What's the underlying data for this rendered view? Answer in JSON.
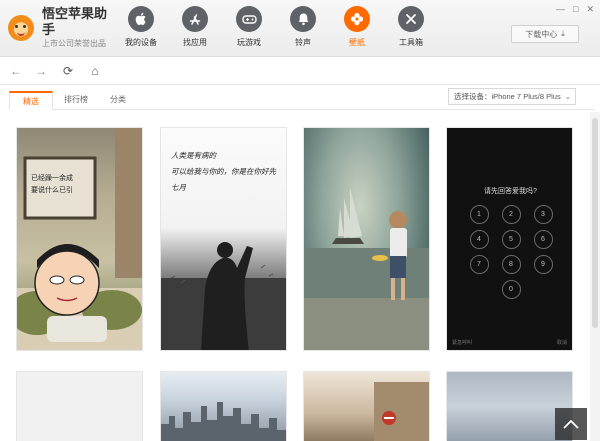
{
  "app": {
    "title": "悟空苹果助手",
    "subtitle": "上市公司荣誉出品"
  },
  "nav": [
    {
      "label": "我的设备",
      "icon": "apple-icon",
      "glyph": ""
    },
    {
      "label": "找应用",
      "icon": "app-store-icon",
      "glyph": "A"
    },
    {
      "label": "玩游戏",
      "icon": "gamepad-icon",
      "glyph": "◎"
    },
    {
      "label": "铃声",
      "icon": "bell-icon",
      "glyph": "♪"
    },
    {
      "label": "壁纸",
      "icon": "wallpaper-icon",
      "glyph": "✿"
    },
    {
      "label": "工具箱",
      "icon": "tools-icon",
      "glyph": "✕"
    }
  ],
  "download_center": {
    "label": "下载中心",
    "icon": "download-icon"
  },
  "window_controls": [
    "—",
    "□",
    "✕"
  ],
  "toolbar": {
    "back": "←",
    "forward": "→",
    "refresh": "⟳",
    "home": "⌂"
  },
  "tabs": [
    "精选",
    "排行榜",
    "分类"
  ],
  "device_select": {
    "label": "选择设备：iPhone 7 Plus/8 Plus"
  },
  "wallpapers": {
    "w1": {
      "text": "已经躁一余成\n要说什么已引"
    },
    "w2": {
      "text": "人类是有病的\n可以给我与你的，你是在你好先\n七月"
    },
    "w4": {
      "title": "请先回答爱我吗?",
      "keys": [
        "1",
        "2",
        "3",
        "4",
        "5",
        "6",
        "7",
        "8",
        "9",
        "0"
      ],
      "foot_left": "紧急呼叫",
      "foot_right": "取消"
    }
  },
  "accent_color": "#ff6a00"
}
